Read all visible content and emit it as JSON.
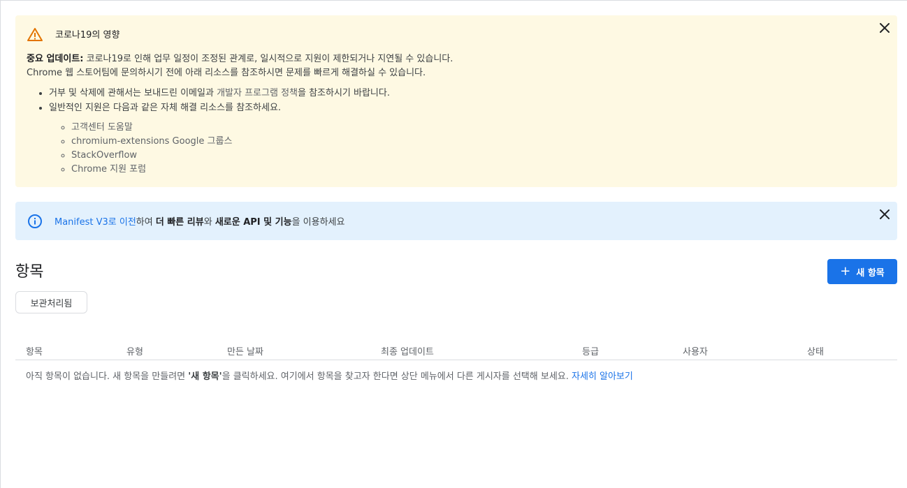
{
  "warning_banner": {
    "title": "코로나19의 영향",
    "update_label": "중요 업데이트:",
    "update_text": " 코로나19로 인해 업무 일정이 조정된 관계로, 일시적으로 지원이 제한되거나 지연될 수 있습니다.",
    "line2": "Chrome 웹 스토어팀에 문의하시기 전에 아래 리소스를 참조하시면 문제를 빠르게 해결하실 수 있습니다.",
    "bullet1_pre": "거부 및 삭제에 관해서는 보내드린 이메일과 ",
    "bullet1_link": "개발자 프로그램 정책",
    "bullet1_post": "을 참조하시기 바랍니다.",
    "bullet2": "일반적인 지원은 다음과 같은 자체 해결 리소스를 참조하세요.",
    "resources": [
      "고객센터 도움말",
      "chromium-extensions Google 그룹스",
      "StackOverflow",
      "Chrome 지원 포럼"
    ]
  },
  "info_banner": {
    "link": "Manifest V3로 이전",
    "t1": "하여 ",
    "b1": "더 빠른 리뷰",
    "t2": "와 ",
    "b2": "새로운 API 및 기능",
    "t3": "을 이용하세요"
  },
  "page": {
    "title": "항목",
    "new_button": "새 항목",
    "archive_button": "보관처리됨"
  },
  "table": {
    "columns": [
      "항목",
      "유형",
      "만든 날짜",
      "최종 업데이트",
      "등급",
      "사용자",
      "상태"
    ],
    "empty_pre": "아직 항목이 없습니다. 새 항목을 만들려면 ",
    "empty_bold": "'새 항목'",
    "empty_post": "을 클릭하세요. 여기에서 항목을 찾고자 한다면 상단 메뉴에서 다른 게시자를 선택해 보세요. ",
    "empty_link": "자세히 알아보기"
  }
}
